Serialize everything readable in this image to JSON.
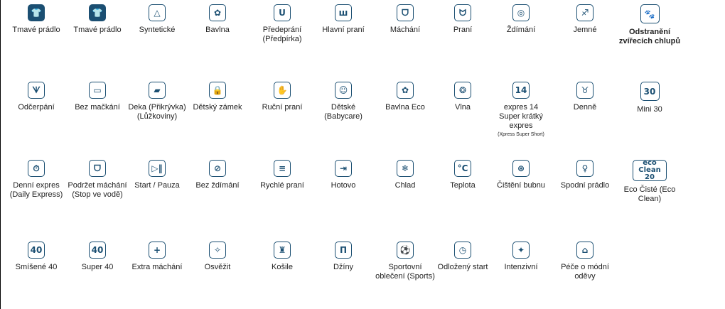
{
  "rows": [
    [
      {
        "label": "Tmavé prádlo",
        "icon": "dark-tshirt-icon",
        "glyph": "👕",
        "dark": true
      },
      {
        "label": "Tmavé prádlo",
        "icon": "tshirt-outline-icon",
        "glyph": "👕",
        "dark": true
      },
      {
        "label": "Syntetické",
        "icon": "synthetic-triangle-icon",
        "glyph": "△"
      },
      {
        "label": "Bavlna",
        "icon": "cotton-flower-icon",
        "glyph": "✿"
      },
      {
        "label": "Předeprání (Předpírka)",
        "icon": "prewash-tub-icon",
        "glyph": "ᑌ"
      },
      {
        "label": "Hlavní praní",
        "icon": "main-wash-tub-icon",
        "glyph": "ш"
      },
      {
        "label": "Máchání",
        "icon": "rinse-tub-icon",
        "glyph": "ᗜ"
      },
      {
        "label": "Praní",
        "icon": "wash-tub-icon",
        "glyph": "ᗢ"
      },
      {
        "label": "Ždímání",
        "icon": "spin-spiral-icon",
        "glyph": "◎"
      },
      {
        "label": "Jemné",
        "icon": "delicate-garment-icon",
        "glyph": "♐"
      },
      {
        "label": "Odstranění zvířecích chlupů",
        "icon": "pet-hair-removal-icon",
        "glyph": "🐾",
        "bold": true,
        "big": true
      }
    ],
    [
      {
        "label": "Odčerpání",
        "icon": "drain-icon",
        "glyph": "ᗐ"
      },
      {
        "label": "Bez mačkání",
        "icon": "no-crease-iron-icon",
        "glyph": "▭"
      },
      {
        "label": "Deka (Přikrývka) (Lůžkoviny)",
        "icon": "blanket-icon",
        "glyph": "▰"
      },
      {
        "label": "Dětský zámek",
        "icon": "child-lock-icon",
        "glyph": "🔒"
      },
      {
        "label": "Ruční praní",
        "icon": "hand-wash-icon",
        "glyph": "✋"
      },
      {
        "label": "Dětské (Babycare)",
        "icon": "baby-face-icon",
        "glyph": "☺"
      },
      {
        "label": "Bavlna Eco",
        "icon": "cotton-eco-icon",
        "glyph": "✿"
      },
      {
        "label": "Vlna",
        "icon": "wool-ball-icon",
        "glyph": "❂"
      },
      {
        "label": "expres 14",
        "sublabel": "Super krátký expres",
        "subsublabel": "(Xpress Super Short)",
        "icon": "express-14-icon",
        "glyph": "14"
      },
      {
        "label": "Denně",
        "icon": "daily-garment-icon",
        "glyph": "♉"
      },
      {
        "label": "Mini 30",
        "icon": "mini-30-icon",
        "glyph": "30",
        "big": true
      }
    ],
    [
      {
        "label": "Denní expres (Daily Express)",
        "icon": "daily-express-icon",
        "glyph": "⏱"
      },
      {
        "label": "Podržet máchání (Stop ve vodě)",
        "icon": "rinse-hold-icon",
        "glyph": "ᗜ"
      },
      {
        "label": "Start / Pauza",
        "icon": "start-pause-icon",
        "glyph": "▷‖"
      },
      {
        "label": "Bez ždímání",
        "icon": "no-spin-icon",
        "glyph": "⊘"
      },
      {
        "label": "Rychlé praní",
        "icon": "quick-wash-icon",
        "glyph": "≡"
      },
      {
        "label": "Hotovo",
        "icon": "finish-arrow-icon",
        "glyph": "⇥"
      },
      {
        "label": "Chlad",
        "icon": "cold-snowflake-icon",
        "glyph": "❄"
      },
      {
        "label": "Teplota",
        "icon": "temperature-celsius-icon",
        "glyph": "°C"
      },
      {
        "label": "Čištění bubnu",
        "icon": "drum-clean-icon",
        "glyph": "⊛"
      },
      {
        "label": "Spodní prádlo",
        "icon": "underwear-icon",
        "glyph": "♀"
      },
      {
        "label": "Eco Čisté (Eco Clean)",
        "icon": "eco-clean-20-icon",
        "glyph": "eco Clean 20",
        "wide": true
      }
    ],
    [
      {
        "label": "Smíšené 40",
        "icon": "mixed-40-icon",
        "glyph": "40"
      },
      {
        "label": "Super 40",
        "icon": "super-40-icon",
        "glyph": "40"
      },
      {
        "label": "Extra máchání",
        "icon": "plus-rinse-icon",
        "glyph": "+"
      },
      {
        "label": "Osvěžit",
        "icon": "refresh-garment-icon",
        "glyph": "✧"
      },
      {
        "label": "Košile",
        "icon": "shirt-icon",
        "glyph": "♜"
      },
      {
        "label": "Džíny",
        "icon": "jeans-icon",
        "glyph": "Π"
      },
      {
        "label": "Sportovní oblečení (Sports)",
        "icon": "sports-icon",
        "glyph": "⚽"
      },
      {
        "label": "Odložený start",
        "icon": "delay-start-timer-icon",
        "glyph": "◷"
      },
      {
        "label": "Intenzivní",
        "icon": "intensive-icon",
        "glyph": "✦"
      },
      {
        "label": "Péče o módní oděvy",
        "icon": "fashion-care-icon",
        "glyph": "⌂"
      }
    ]
  ]
}
